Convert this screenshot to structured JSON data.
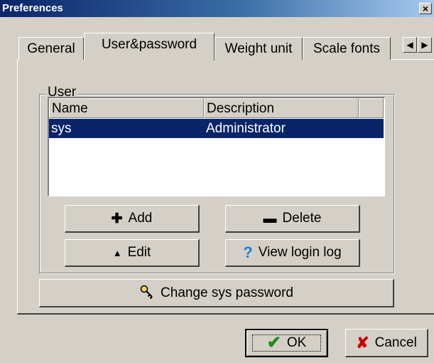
{
  "window": {
    "title": "Preferences",
    "close_glyph": "×"
  },
  "tabs": [
    {
      "label": "General",
      "active": false
    },
    {
      "label": "User&password",
      "active": true
    },
    {
      "label": "Weight unit",
      "active": false
    },
    {
      "label": "Scale fonts",
      "active": false
    }
  ],
  "tab_scroll": {
    "left_icon": "arrow-left-icon",
    "right_icon": "arrow-right-icon"
  },
  "user_group": {
    "label": "User",
    "columns": [
      "Name",
      "Description"
    ],
    "rows": [
      {
        "name": "sys",
        "description": "Administrator",
        "selected": true
      }
    ],
    "buttons": {
      "add": "Add",
      "delete": "Delete",
      "edit": "Edit",
      "view_log": "View login log"
    }
  },
  "change_password_label": "Change sys password",
  "dialog_buttons": {
    "ok": "OK",
    "cancel": "Cancel"
  },
  "colors": {
    "selection": "#0a246a",
    "face": "#d4d0c8",
    "help_icon": "#1e7dd6",
    "ok_check": "#1a8c1a",
    "cancel_x": "#cc0000"
  }
}
